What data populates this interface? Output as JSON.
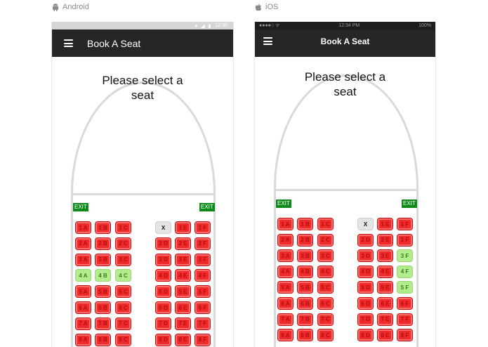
{
  "labels": {
    "android": "Android",
    "ios": "iOS"
  },
  "colors": {
    "appbar": "#262626",
    "booked": "#ef2a2a",
    "available": "#b3ec8c",
    "selected": "#e4e4e4",
    "exit": "#0d8a1a",
    "fuselage": "#d9d9d9"
  },
  "android": {
    "status_time": "12:30",
    "title": "Book A Seat",
    "prompt": "Please select a seat",
    "exit": "EXIT",
    "seat_rows": [
      [
        {
          "label": "1 A",
          "state": "booked"
        },
        {
          "label": "1 B",
          "state": "booked"
        },
        {
          "label": "1 C",
          "state": "booked"
        },
        {
          "label": "X",
          "state": "selected"
        },
        {
          "label": "1 E",
          "state": "booked"
        },
        {
          "label": "1 F",
          "state": "booked"
        }
      ],
      [
        {
          "label": "2 A",
          "state": "booked"
        },
        {
          "label": "2 B",
          "state": "booked"
        },
        {
          "label": "2 C",
          "state": "booked"
        },
        {
          "label": "2 D",
          "state": "booked"
        },
        {
          "label": "2 E",
          "state": "booked"
        },
        {
          "label": "2 F",
          "state": "booked"
        }
      ],
      [
        {
          "label": "3 A",
          "state": "booked"
        },
        {
          "label": "3 B",
          "state": "booked"
        },
        {
          "label": "3 C",
          "state": "booked"
        },
        {
          "label": "3 D",
          "state": "booked"
        },
        {
          "label": "3 E",
          "state": "booked"
        },
        {
          "label": "3 F",
          "state": "booked"
        }
      ],
      [
        {
          "label": "4 A",
          "state": "available"
        },
        {
          "label": "4 B",
          "state": "available"
        },
        {
          "label": "4 C",
          "state": "available"
        },
        {
          "label": "4 D",
          "state": "booked"
        },
        {
          "label": "4 E",
          "state": "booked"
        },
        {
          "label": "4 F",
          "state": "booked"
        }
      ],
      [
        {
          "label": "5 A",
          "state": "booked"
        },
        {
          "label": "5 B",
          "state": "booked"
        },
        {
          "label": "5 C",
          "state": "booked"
        },
        {
          "label": "5 D",
          "state": "booked"
        },
        {
          "label": "5 E",
          "state": "booked"
        },
        {
          "label": "5 F",
          "state": "booked"
        }
      ],
      [
        {
          "label": "6 A",
          "state": "booked"
        },
        {
          "label": "6 B",
          "state": "booked"
        },
        {
          "label": "6 C",
          "state": "booked"
        },
        {
          "label": "6 D",
          "state": "booked"
        },
        {
          "label": "6 E",
          "state": "booked"
        },
        {
          "label": "6 F",
          "state": "booked"
        }
      ],
      [
        {
          "label": "7 A",
          "state": "booked"
        },
        {
          "label": "7 B",
          "state": "booked"
        },
        {
          "label": "7 C",
          "state": "booked"
        },
        {
          "label": "7 D",
          "state": "booked"
        },
        {
          "label": "7 E",
          "state": "booked"
        },
        {
          "label": "7 F",
          "state": "booked"
        }
      ],
      [
        {
          "label": "8 A",
          "state": "booked"
        },
        {
          "label": "8 B",
          "state": "booked"
        },
        {
          "label": "8 C",
          "state": "booked"
        },
        {
          "label": "8 D",
          "state": "booked"
        },
        {
          "label": "8 E",
          "state": "booked"
        },
        {
          "label": "8 F",
          "state": "booked"
        }
      ]
    ]
  },
  "ios": {
    "status_carrier": "●●●●○ ᯤ",
    "status_time": "12:34 PM",
    "status_battery": "100%",
    "title": "Book A Seat",
    "prompt": "Please select a seat",
    "exit": "EXIT",
    "seat_rows": [
      [
        {
          "label": "1 A",
          "state": "booked"
        },
        {
          "label": "1 B",
          "state": "booked"
        },
        {
          "label": "1 C",
          "state": "booked"
        },
        {
          "label": "X",
          "state": "selected"
        },
        {
          "label": "1 E",
          "state": "booked"
        },
        {
          "label": "1 F",
          "state": "booked"
        }
      ],
      [
        {
          "label": "2 A",
          "state": "booked"
        },
        {
          "label": "2 B",
          "state": "booked"
        },
        {
          "label": "2 C",
          "state": "booked"
        },
        {
          "label": "2 D",
          "state": "booked"
        },
        {
          "label": "2 E",
          "state": "booked"
        },
        {
          "label": "2 F",
          "state": "booked"
        }
      ],
      [
        {
          "label": "3 A",
          "state": "booked"
        },
        {
          "label": "3 B",
          "state": "booked"
        },
        {
          "label": "3 C",
          "state": "booked"
        },
        {
          "label": "3 D",
          "state": "booked"
        },
        {
          "label": "3 E",
          "state": "booked"
        },
        {
          "label": "3 F",
          "state": "available"
        }
      ],
      [
        {
          "label": "4 A",
          "state": "booked"
        },
        {
          "label": "4 B",
          "state": "booked"
        },
        {
          "label": "4 C",
          "state": "booked"
        },
        {
          "label": "4 D",
          "state": "booked"
        },
        {
          "label": "4 E",
          "state": "booked"
        },
        {
          "label": "4 F",
          "state": "available"
        }
      ],
      [
        {
          "label": "5 A",
          "state": "booked"
        },
        {
          "label": "5 B",
          "state": "booked"
        },
        {
          "label": "5 C",
          "state": "booked"
        },
        {
          "label": "5 D",
          "state": "booked"
        },
        {
          "label": "5 E",
          "state": "booked"
        },
        {
          "label": "5 F",
          "state": "available"
        }
      ],
      [
        {
          "label": "6 A",
          "state": "booked"
        },
        {
          "label": "6 B",
          "state": "booked"
        },
        {
          "label": "6 C",
          "state": "booked"
        },
        {
          "label": "6 D",
          "state": "booked"
        },
        {
          "label": "6 E",
          "state": "booked"
        },
        {
          "label": "6 F",
          "state": "booked"
        }
      ],
      [
        {
          "label": "7 A",
          "state": "booked"
        },
        {
          "label": "7 B",
          "state": "booked"
        },
        {
          "label": "7 C",
          "state": "booked"
        },
        {
          "label": "7 D",
          "state": "booked"
        },
        {
          "label": "7 E",
          "state": "booked"
        },
        {
          "label": "7 F",
          "state": "booked"
        }
      ],
      [
        {
          "label": "8 A",
          "state": "booked"
        },
        {
          "label": "8 B",
          "state": "booked"
        },
        {
          "label": "8 C",
          "state": "booked"
        },
        {
          "label": "8 D",
          "state": "booked"
        },
        {
          "label": "8 E",
          "state": "booked"
        },
        {
          "label": "8 F",
          "state": "booked"
        }
      ]
    ]
  }
}
